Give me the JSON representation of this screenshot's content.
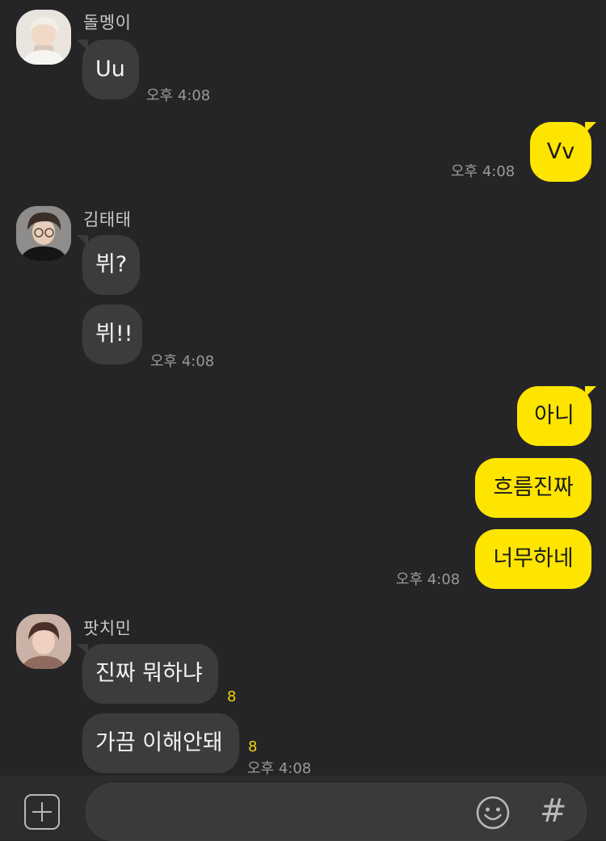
{
  "messages": [
    {
      "sender": "돌멩이",
      "text": "Uu",
      "time": "오후 4:08"
    },
    {
      "sender": "me",
      "text": "Vv",
      "time": "오후 4:08"
    },
    {
      "sender": "김태태",
      "texts": [
        "뷔?",
        "뷔!!"
      ],
      "time": "오후 4:08"
    },
    {
      "sender": "me",
      "texts": [
        "아니",
        "흐름진짜",
        "너무하네"
      ],
      "time": "오후 4:08"
    },
    {
      "sender": "팟치민",
      "texts": [
        "진짜 뭐하냐",
        "가끔 이해안돼"
      ],
      "unread": [
        "8",
        "8"
      ],
      "time": "오후 4:08"
    }
  ],
  "composer": {
    "input_value": "",
    "plus_icon": "plus-square-icon",
    "emoji_icon": "smiley-icon",
    "hash_label": "#"
  },
  "colors": {
    "background": "#252527",
    "incoming_bubble": "#3c3c3e",
    "outgoing_bubble": "#fee500",
    "unread_count": "#f4d20a"
  }
}
